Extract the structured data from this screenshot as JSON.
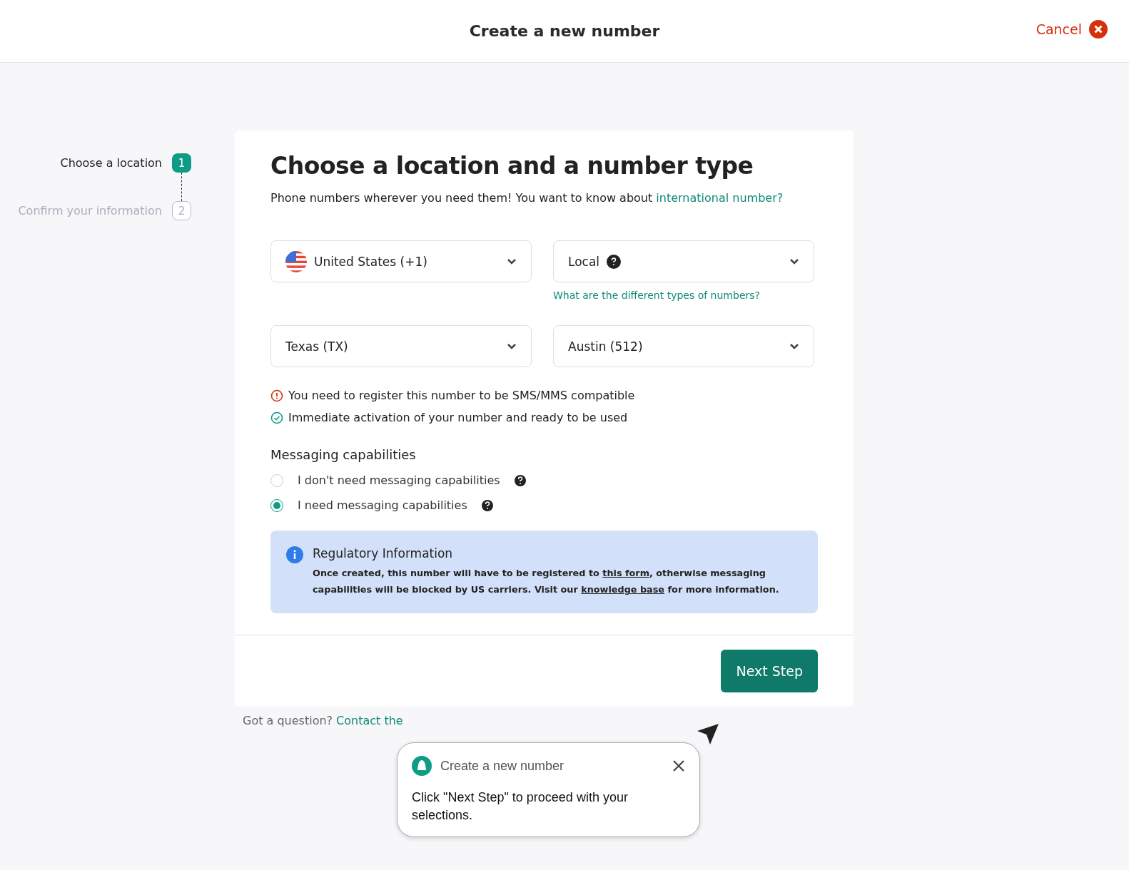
{
  "header": {
    "title": "Create a new number",
    "cancel": "Cancel"
  },
  "steps": [
    {
      "label": "Choose a location",
      "number": "1",
      "selected": true
    },
    {
      "label": "Confirm your information",
      "number": "2",
      "selected": false
    }
  ],
  "form": {
    "heading": "Choose a location and a number type",
    "intro": "Phone numbers wherever you need them! You want to know about ",
    "intro_link": "international number?",
    "selects": [
      {
        "value": "United States (+1)",
        "kind": "flag"
      },
      {
        "value": "Local",
        "kind": "help"
      },
      {
        "value": "Texas (TX)",
        "kind": "plain"
      },
      {
        "value": "Austin (512)",
        "kind": "plain"
      }
    ],
    "types_link": "What are the different types of numbers?",
    "notices": [
      {
        "kind": "warning",
        "text": "You need to register this number to be SMS/MMS compatible"
      },
      {
        "kind": "ok",
        "text": "Immediate activation of your number and ready to be used"
      }
    ],
    "messaging_title": "Messaging capabilities",
    "options": [
      {
        "label": "I don't need messaging capabilities",
        "selected": false
      },
      {
        "label": "I need messaging capabilities",
        "selected": true
      }
    ],
    "regulatory": {
      "title": "Regulatory Information",
      "parts": [
        {
          "text": "Once created, this number will have to be registered to ",
          "link": false
        },
        {
          "text": "this form",
          "link": true
        },
        {
          "text": ", otherwise messaging capabilities will be blocked by US carriers. Visit our ",
          "link": false
        },
        {
          "text": "knowledge base",
          "link": true
        },
        {
          "text": " for more information.",
          "link": false
        }
      ]
    },
    "next": "Next Step"
  },
  "footer": {
    "text": "Got a question?",
    "link": "Contact the"
  },
  "tooltip": {
    "title": "Create a new number",
    "body": "Click \"Next Step\" to proceed with your selections."
  }
}
